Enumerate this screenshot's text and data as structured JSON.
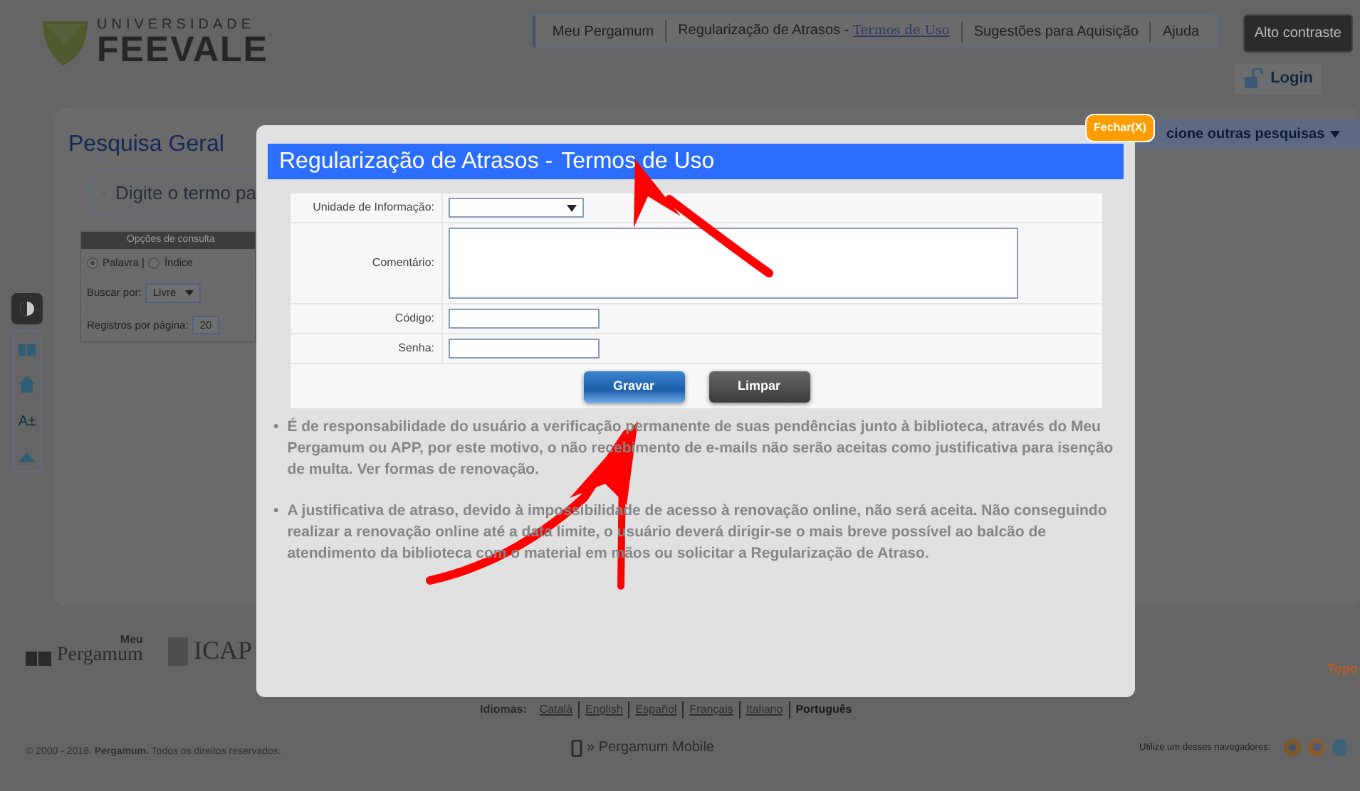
{
  "header": {
    "logo_top": "UNIVERSIDADE",
    "logo_bottom": "FEEVALE",
    "nav": [
      {
        "label": "Meu Pergamum"
      },
      {
        "label": "Regularização de Atrasos -",
        "link": "Termos de Uso"
      },
      {
        "label": "Sugestões para Aquisição"
      },
      {
        "label": "Ajuda"
      }
    ],
    "contrast_button": "Alto contraste",
    "login": "Login"
  },
  "sidebar": {
    "font_size": "A±"
  },
  "search_panel": {
    "title": "Pesquisa Geral",
    "search_placeholder": "Digite o termo pa",
    "options_title": "Opções de consulta",
    "radios": [
      {
        "label": "Palavra |",
        "selected": true
      },
      {
        "label": "Índice",
        "selected": false
      }
    ],
    "search_by_label": "Buscar por:",
    "search_by_value": "Livre",
    "per_page_label": "Registros por página:",
    "per_page_value": "20",
    "other_searches": "cione outras pesquisas"
  },
  "modal": {
    "close": "Fechar(X)",
    "title": "Regularização de Atrasos -",
    "title_link": "Termos de Uso",
    "fields": [
      {
        "kind": "select",
        "label": "Unidade de Informação:"
      },
      {
        "kind": "textarea",
        "label": "Comentário:"
      },
      {
        "kind": "text",
        "label": "Código:"
      },
      {
        "kind": "password",
        "label": "Senha:"
      }
    ],
    "buttons": [
      {
        "kind": "primary",
        "label": "Gravar"
      },
      {
        "kind": "secondary",
        "label": "Limpar"
      }
    ],
    "notices": [
      {
        "marker": "•",
        "text": "É de responsabilidade do usuário a verificação permanente de suas pendências junto à biblioteca, através do Meu Pergamum ou APP, por este motivo, o não recebimento de e-mails não serão aceitas como justificativa para isenção de multa.",
        "link": "Ver formas de renovação",
        "after": "."
      },
      {
        "marker": "•",
        "text": "A justificativa de atraso, devido à impossibilidade de acesso à renovação online, não será aceita. Não conseguindo realizar a renovação online até a data limite, o usuário deverá dirigir-se o mais breve possível ao balcão de atendimento da biblioteca com o material em mãos ou solicitar a",
        "link": "Regularização de Atraso",
        "after": "."
      }
    ]
  },
  "footer": {
    "logo_meu": "Meu",
    "logo_pergamum": "Pergamum",
    "icap": "ICAP",
    "topo": "Topo",
    "languages_label": "Idiomas:",
    "languages": [
      {
        "label": "Català",
        "selected": false
      },
      {
        "label": "English",
        "selected": false
      },
      {
        "label": "Español",
        "selected": false
      },
      {
        "label": "Français",
        "selected": false
      },
      {
        "label": "Italiano",
        "selected": false
      },
      {
        "label": "Português",
        "selected": true
      }
    ],
    "copyright": "© 2000 - 2018. **Pergamum.** Todos os direitos reservados.",
    "mobile": "» Pergamum Mobile",
    "browsers_label": "Utilize um desses navegadores:"
  }
}
